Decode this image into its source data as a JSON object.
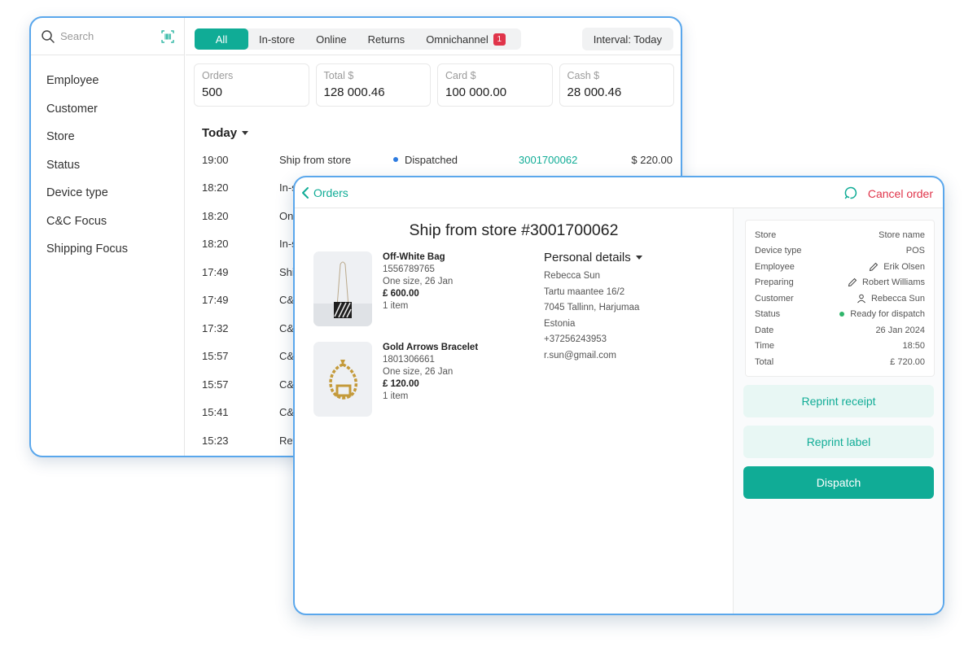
{
  "search": {
    "placeholder": "Search"
  },
  "filters": [
    "Employee",
    "Customer",
    "Store",
    "Status",
    "Device type",
    "C&C Focus",
    "Shipping Focus"
  ],
  "tabs": [
    {
      "label": "All",
      "active": true
    },
    {
      "label": "In-store"
    },
    {
      "label": "Online"
    },
    {
      "label": "Returns"
    },
    {
      "label": "Omnichannel",
      "badge": "1"
    }
  ],
  "interval": "Interval: Today",
  "stats": [
    {
      "label": "Orders",
      "value": "500"
    },
    {
      "label": "Total $",
      "value": "128 000.46"
    },
    {
      "label": "Card $",
      "value": "100 000.00"
    },
    {
      "label": "Cash $",
      "value": "28 000.46"
    }
  ],
  "section_label": "Today",
  "orders": [
    {
      "time": "19:00",
      "type": "Ship from store",
      "status": "Dispatched",
      "id": "3001700062",
      "amount": "$ 220.00"
    },
    {
      "time": "18:20",
      "type": "In-s"
    },
    {
      "time": "18:20",
      "type": "On"
    },
    {
      "time": "18:20",
      "type": "In-s"
    },
    {
      "time": "17:49",
      "type": "Shi"
    },
    {
      "time": "17:49",
      "type": "C&"
    },
    {
      "time": "17:32",
      "type": "C&"
    },
    {
      "time": "15:57",
      "type": "C&"
    },
    {
      "time": "15:57",
      "type": "C&"
    },
    {
      "time": "15:41",
      "type": "C&"
    },
    {
      "time": "15:23",
      "type": "Ret"
    }
  ],
  "detail": {
    "back_label": "Orders",
    "cancel_label": "Cancel order",
    "title": "Ship from store #3001700062",
    "products": [
      {
        "name": "Off-White Bag",
        "sku": "1556789765",
        "variant": "One size, 26 Jan",
        "price": "£ 600.00",
        "qty": "1 item",
        "image": "bag"
      },
      {
        "name": "Gold Arrows Bracelet",
        "sku": "1801306661",
        "variant": "One size, 26 Jan",
        "price": "£ 120.00",
        "qty": "1 item",
        "image": "bracelet"
      }
    ],
    "personal": {
      "title": "Personal details",
      "lines": [
        "Rebecca Sun",
        "Tartu maantee 16/2",
        "7045 Tallinn, Harjumaa",
        "Estonia",
        "+37256243953",
        "r.sun@gmail.com"
      ]
    },
    "info": [
      {
        "label": "Store",
        "value": "Store name"
      },
      {
        "label": "Device type",
        "value": "POS"
      },
      {
        "label": "Employee",
        "value": "Erik Olsen",
        "icon": "pencil-icon"
      },
      {
        "label": "Preparing",
        "value": "Robert Williams",
        "icon": "pencil-icon"
      },
      {
        "label": "Customer",
        "value": "Rebecca Sun",
        "icon": "person-icon"
      },
      {
        "label": "Status",
        "value": "Ready for dispatch",
        "icon": "status-dot"
      },
      {
        "label": "Date",
        "value": "26 Jan 2024"
      },
      {
        "label": "Time",
        "value": "18:50"
      },
      {
        "label": "Total",
        "value": "£ 720.00"
      }
    ],
    "buttons": {
      "reprint_receipt": "Reprint receipt",
      "reprint_label": "Reprint label",
      "dispatch": "Dispatch"
    }
  },
  "colors": {
    "accent": "#10ac96",
    "danger": "#e0344a",
    "frame": "#5aa7ec",
    "status_dispatched": "#2d7be0",
    "status_ready": "#2fb56a"
  }
}
